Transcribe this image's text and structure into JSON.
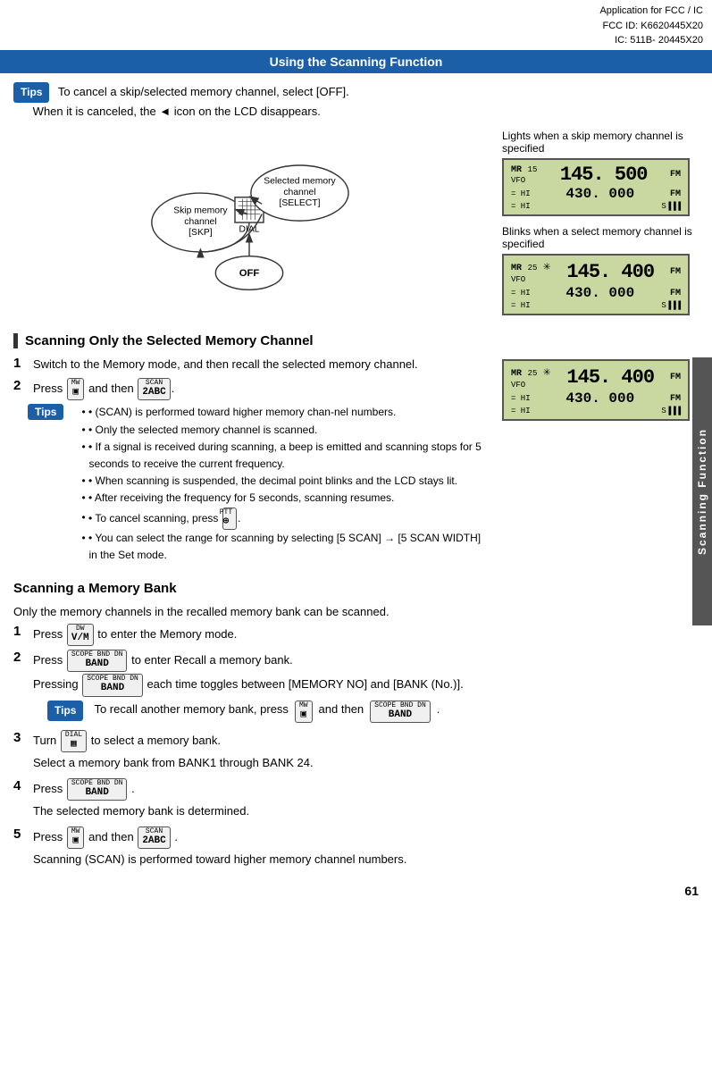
{
  "header": {
    "line1": "Application for FCC / IC",
    "line2": "FCC ID: K6620445X20",
    "line3": "IC: 511B- 20445X20",
    "section_title": "Using the Scanning Function"
  },
  "tips_section": {
    "badge": "Tips",
    "line1": "To cancel a skip/selected memory channel, select [OFF].",
    "line2": "When it is canceled, the ◄ icon on the LCD disappears."
  },
  "diagram": {
    "skip_label": "Skip memory",
    "skip_label2": "channel",
    "skip_label3": "[SKP]",
    "dial_label": "DIAL",
    "selected_label": "Selected memory",
    "selected_label2": "channel",
    "selected_label3": "[SELECT]",
    "off_label": "OFF"
  },
  "lcd1": {
    "label": "Lights when a skip memory channel is specified",
    "mr": "MR",
    "num1": "15",
    "vfo": "VFO",
    "freq_large": "145. 500",
    "fm1": "FM",
    "mid_left": "= HI",
    "freq_small": "430. 000",
    "fm2": "FM",
    "bot_left": "= HI",
    "s_badge": "S▐▐▐"
  },
  "lcd2": {
    "label": "Blinks when a select memory channel is specified",
    "mr": "MR",
    "num1": "25",
    "vfo": "VFO",
    "freq_large": "145. 400",
    "fm1": "FM",
    "mid_left": "= HI",
    "freq_small": "430. 000",
    "fm2": "FM",
    "bot_left": "= HI",
    "s_badge": "S▐▐▐"
  },
  "scanning_selected": {
    "title": "Scanning Only the Selected Memory Channel",
    "step1_num": "1",
    "step1_text": "Switch to the Memory mode, and then recall the selected memory channel.",
    "step2_num": "2",
    "step2_text": "Press",
    "step2_mw": "MW",
    "step2_key1": "▣",
    "step2_and": "and then",
    "step2_scan": "SCAN",
    "step2_key2": "2ABC",
    "tips_badge": "Tips",
    "tips": [
      "• (SCAN) is performed toward higher memory chan-nel numbers.",
      "• Only the selected memory channel is scanned.",
      "• If a signal is received during scanning, a beep is emitted and scanning stops for 5 seconds to receive the current frequency.",
      "• When scanning is suspended, the decimal point blinks and the LCD stays lit.",
      "• After receiving the frequency for 5 seconds, scanning resumes.",
      "• To cancel scanning, press      .",
      "• You can select the range for scanning by selecting [5 SCAN] → [5 SCAN WIDTH] in the Set mode."
    ]
  },
  "lcd3": {
    "mr": "MR",
    "num1": "25",
    "vfo": "VFO",
    "freq_large": "145. 400",
    "fm1": "FM",
    "mid_left": "= HI",
    "freq_small": "430. 000",
    "fm2": "FM",
    "bot_left": "= HI",
    "s_badge": "S▐▐▐"
  },
  "scanning_bank": {
    "title": "Scanning a Memory Bank",
    "intro": "Only the memory channels in the recalled memory bank can be scanned.",
    "step1_num": "1",
    "step1_text": "Press",
    "step1_key_top": "DW",
    "step1_key_main": "V/M",
    "step1_rest": "to enter the Memory mode.",
    "step2_num": "2",
    "step2_text": "Press",
    "step2_key_top": "SCOPE BND DN",
    "step2_key_main": "BAND",
    "step2_rest": "to enter Recall a memory bank.",
    "step2_pressing": "Pressing",
    "step2_each": "each time toggles between [MEMORY NO] and [BANK (No.)].",
    "step2_tips_badge": "Tips",
    "step2_tips": "To recall another memory bank, press",
    "step2_tips_key1_top": "MW",
    "step2_tips_key1": "▣",
    "step2_tips_and": "and then",
    "step2_tips_key2_top": "SCOPE BND DN",
    "step2_tips_key2": "BAND",
    "step3_num": "3",
    "step3_turn": "Turn",
    "step3_key_top": "DIAL",
    "step3_key_main": "▦",
    "step3_rest": "to select a memory bank.",
    "step3_select": "Select a memory bank from BANK1 through BANK 24.",
    "step4_num": "4",
    "step4_text": "Press",
    "step4_key_top": "SCOPE BND DN",
    "step4_key_main": "BAND",
    "step4_rest": ".",
    "step4_result": "The selected memory bank is determined.",
    "step5_num": "5",
    "step5_text": "Press",
    "step5_key1_top": "MW",
    "step5_key1": "▣",
    "step5_and": "and then",
    "step5_key2_top": "SCAN",
    "step5_key2": "2ABC",
    "step5_rest": ".",
    "step5_result": "Scanning (SCAN) is performed toward higher memory channel numbers."
  },
  "sidebar": {
    "text": "Scanning Function"
  },
  "page": {
    "number": "61"
  }
}
